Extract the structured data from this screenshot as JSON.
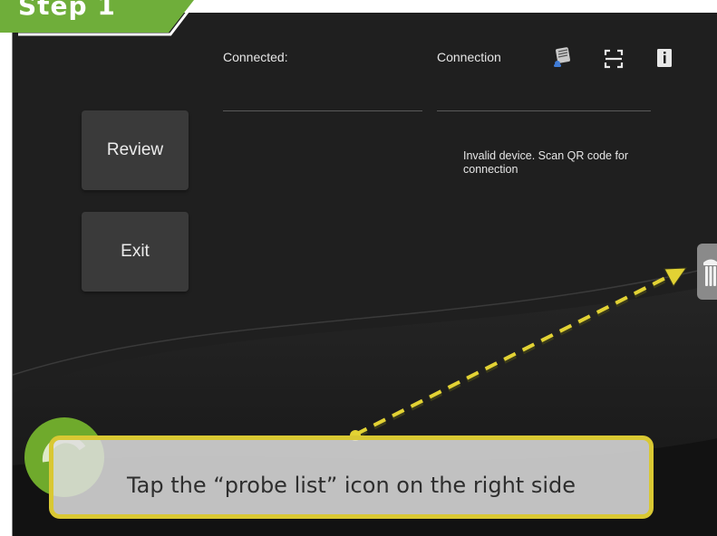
{
  "tutorial": {
    "step_label": "Step 1",
    "instruction": "Tap the “probe list” icon on the right side",
    "accent_color": "#6fae3a",
    "highlight_color": "#d9c833"
  },
  "header": {
    "connected_label": "Connected:",
    "connection_label": "Connection",
    "icons": [
      "settings-icon",
      "scan-qr-icon",
      "info-icon"
    ]
  },
  "sidebar": {
    "review_label": "Review",
    "exit_label": "Exit"
  },
  "status": {
    "message": "Invalid device. Scan QR code for connection"
  },
  "probe_tab": {
    "icon": "probe-icon"
  }
}
